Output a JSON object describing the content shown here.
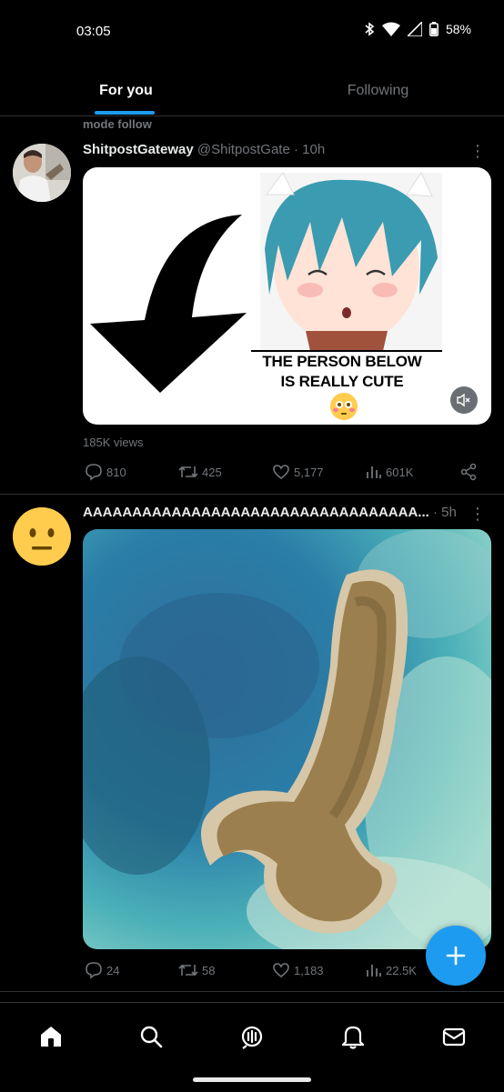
{
  "status_bar": {
    "time": "03:05",
    "battery": "58%",
    "icons": [
      "bluetooth-icon",
      "wifi-icon",
      "signal-icon",
      "battery-icon"
    ]
  },
  "tabs": [
    {
      "label": "For you",
      "active": true
    },
    {
      "label": "Following",
      "active": false
    }
  ],
  "feed": {
    "posts": [
      {
        "context": "mode follow",
        "name": "ShitpostGateway",
        "handle": "@ShitpostGate",
        "time": "· 10h",
        "media": {
          "caption_lines": [
            "THE PERSON BELOW",
            "IS REALLY CUTE"
          ],
          "muted": true
        },
        "views": "185K views",
        "stats": {
          "replies": "810",
          "reposts": "425",
          "likes": "5,177",
          "views": "601K"
        }
      },
      {
        "name": "AAAAAAAAAAAAAAAAAAAAAAAAAAAAAAAAAA...",
        "time": "· 5h",
        "stats": {
          "replies": "24",
          "reposts": "58",
          "likes": "1,183",
          "views": "22.5K"
        }
      }
    ]
  },
  "bottom_nav": [
    "home-icon",
    "search-icon",
    "spaces-icon",
    "notifications-icon",
    "messages-icon"
  ],
  "colors": {
    "accent": "#1d9bf0",
    "background": "#000000",
    "secondary_text": "#71767b",
    "divider": "#2f3336"
  }
}
